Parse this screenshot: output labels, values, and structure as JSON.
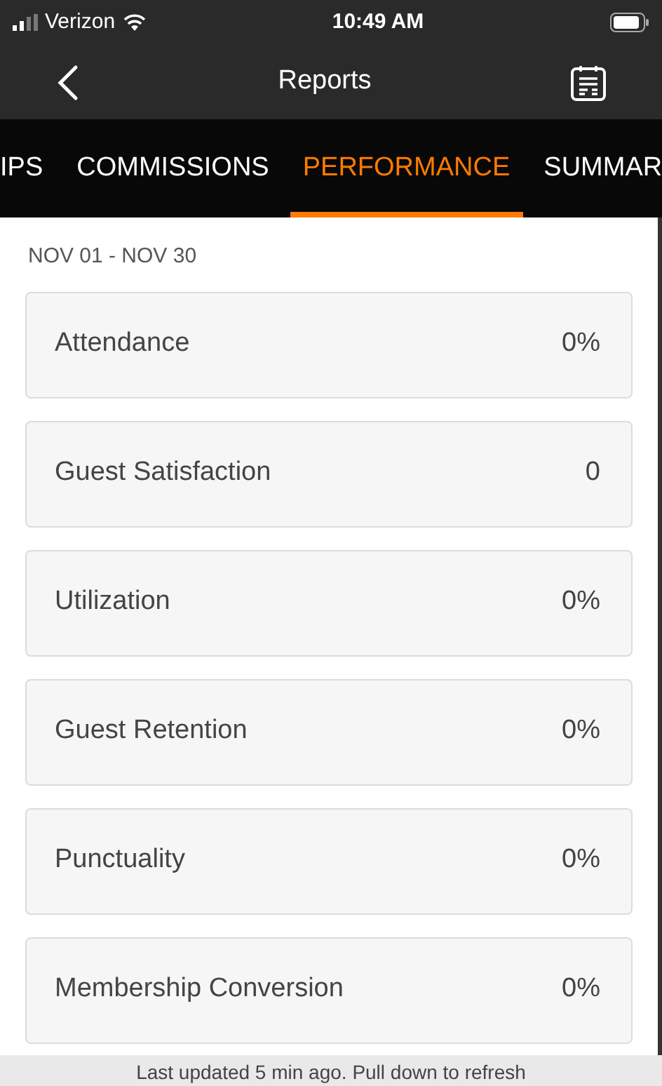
{
  "status_bar": {
    "carrier": "Verizon",
    "time": "10:49 AM"
  },
  "nav": {
    "title": "Reports"
  },
  "tabs": [
    {
      "label": "IPS",
      "selected": false
    },
    {
      "label": "COMMISSIONS",
      "selected": false
    },
    {
      "label": "PERFORMANCE",
      "selected": true
    },
    {
      "label": "SUMMAR",
      "selected": false
    }
  ],
  "date_range": "NOV 01 - NOV 30",
  "metrics": [
    {
      "name": "Attendance",
      "value": "0%"
    },
    {
      "name": "Guest Satisfaction",
      "value": "0"
    },
    {
      "name": "Utilization",
      "value": "0%"
    },
    {
      "name": "Guest Retention",
      "value": "0%"
    },
    {
      "name": "Punctuality",
      "value": "0%"
    },
    {
      "name": "Membership Conversion",
      "value": "0%"
    }
  ],
  "footer": "Last updated 5 min ago. Pull down to refresh"
}
